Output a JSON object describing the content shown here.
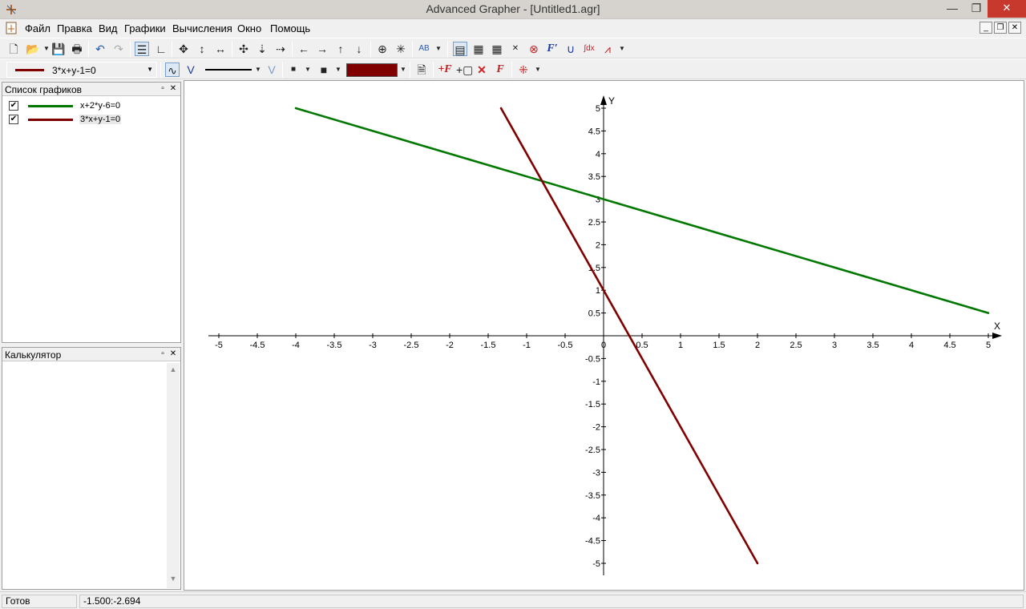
{
  "window": {
    "title": "Advanced Grapher - [Untitled1.agr]",
    "minimize": "—",
    "restore": "❐",
    "close": "✕"
  },
  "menu": [
    "Файл",
    "Правка",
    "Вид",
    "Графики",
    "Вычисления",
    "Окно",
    "Помощь"
  ],
  "mdi_controls": [
    "_",
    "❐",
    "✕"
  ],
  "toolbar2": {
    "current_graph": "3*x+y-1=0",
    "current_color": "#800000"
  },
  "graph_list": {
    "title": "Список графиков",
    "items": [
      {
        "label": "x+2*y-6=0",
        "color": "#007800",
        "checked": "✔",
        "selected": false
      },
      {
        "label": "3*x+y-1=0",
        "color": "#800000",
        "checked": "✔",
        "selected": true
      }
    ]
  },
  "calculator": {
    "title": "Калькулятор",
    "scroll_up": "▲",
    "scroll_down": "▼"
  },
  "status": {
    "ready": "Готов",
    "coords": "-1.500:-2.694"
  },
  "chart_data": {
    "type": "line",
    "x_axis_label": "X",
    "y_axis_label": "Y",
    "xlim": [
      -5,
      5
    ],
    "ylim": [
      -5,
      5
    ],
    "x_ticks": [
      -5,
      -4.5,
      -4,
      -3.5,
      -3,
      -2.5,
      -2,
      -1.5,
      -1,
      -0.5,
      0,
      0.5,
      1,
      1.5,
      2,
      2.5,
      3,
      3.5,
      4,
      4.5,
      5
    ],
    "y_ticks": [
      -5,
      -4.5,
      -4,
      -3.5,
      -3,
      -2.5,
      -2,
      -1.5,
      -1,
      -0.5,
      0.5,
      1,
      1.5,
      2,
      2.5,
      3,
      3.5,
      4,
      4.5,
      5
    ],
    "origin_label": "0",
    "series": [
      {
        "name": "x+2*y-6=0",
        "color": "#007800",
        "x": [
          -4,
          5
        ],
        "y": [
          5,
          0.5
        ]
      },
      {
        "name": "3*x+y-1=0",
        "color": "#800000",
        "x": [
          -1.333,
          2
        ],
        "y": [
          5,
          -5
        ]
      }
    ]
  }
}
